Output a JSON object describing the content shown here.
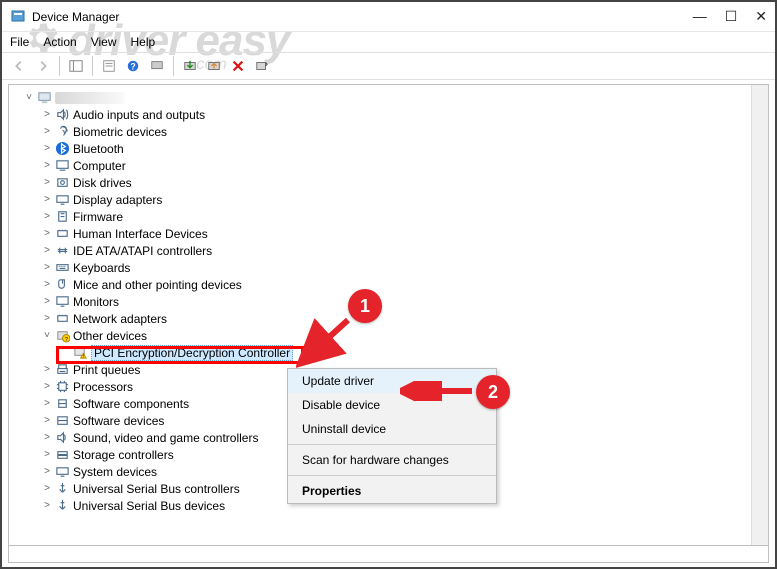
{
  "watermark": {
    "text": "driver easy",
    "sub": ".com"
  },
  "window": {
    "title": "Device Manager"
  },
  "menu": {
    "file": "File",
    "action": "Action",
    "view": "View",
    "help": "Help"
  },
  "tree": {
    "root": "",
    "items": [
      {
        "label": "Audio inputs and outputs",
        "expandable": true
      },
      {
        "label": "Biometric devices",
        "expandable": true
      },
      {
        "label": "Bluetooth",
        "expandable": true
      },
      {
        "label": "Computer",
        "expandable": true
      },
      {
        "label": "Disk drives",
        "expandable": true
      },
      {
        "label": "Display adapters",
        "expandable": true
      },
      {
        "label": "Firmware",
        "expandable": true
      },
      {
        "label": "Human Interface Devices",
        "expandable": true
      },
      {
        "label": "IDE ATA/ATAPI controllers",
        "expandable": true
      },
      {
        "label": "Keyboards",
        "expandable": true
      },
      {
        "label": "Mice and other pointing devices",
        "expandable": true
      },
      {
        "label": "Monitors",
        "expandable": true
      },
      {
        "label": "Network adapters",
        "expandable": true
      },
      {
        "label": "Other devices",
        "expandable": true,
        "expanded": true
      },
      {
        "label": "Print queues",
        "expandable": true
      },
      {
        "label": "Processors",
        "expandable": true
      },
      {
        "label": "Software components",
        "expandable": true
      },
      {
        "label": "Software devices",
        "expandable": true
      },
      {
        "label": "Sound, video and game controllers",
        "expandable": true
      },
      {
        "label": "Storage controllers",
        "expandable": true
      },
      {
        "label": "System devices",
        "expandable": true
      },
      {
        "label": "Universal Serial Bus controllers",
        "expandable": true
      },
      {
        "label": "Universal Serial Bus devices",
        "expandable": true
      }
    ],
    "selected_child": "PCI Encryption/Decryption Controller"
  },
  "context_menu": {
    "update": "Update driver",
    "disable": "Disable device",
    "uninstall": "Uninstall device",
    "scan": "Scan for hardware changes",
    "properties": "Properties"
  },
  "annotations": {
    "one": "1",
    "two": "2"
  }
}
